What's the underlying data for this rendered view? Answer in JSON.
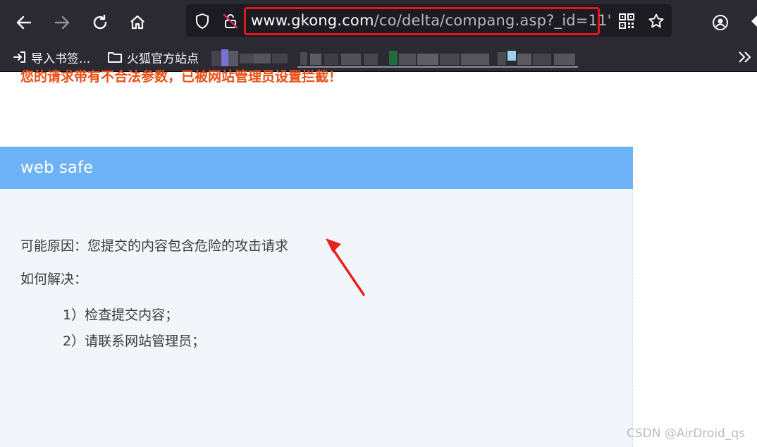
{
  "browser": {
    "url_domain": "www.gkong.com",
    "url_path": "/co/delta/compang.asp?_id=11'",
    "bookmarks": [
      {
        "label": "导入书签..."
      },
      {
        "label": "火狐官方站点"
      }
    ],
    "icons": [
      "back-icon",
      "forward-icon",
      "reload-icon",
      "home-icon",
      "shield-icon",
      "insecure-lock-icon",
      "qr-code-icon",
      "bookmark-star-icon",
      "account-icon",
      "overflow-chevron-icon"
    ]
  },
  "page": {
    "header_title": "web safe",
    "warning": "您的请求带有不合法参数，已被网站管理员设置拦截！",
    "reason": "可能原因：您提交的内容包含危险的攻击请求",
    "solve_title": "如何解决：",
    "steps": [
      "1）检查提交内容；",
      "2）请联系网站管理员；"
    ]
  },
  "watermark": "CSDN @AirDroid_qs",
  "colors": {
    "header_bg": "#6db2f6",
    "warning": "#ea4e14",
    "highlight_box": "#e6141e",
    "annotation_arrow": "#e8211c"
  }
}
